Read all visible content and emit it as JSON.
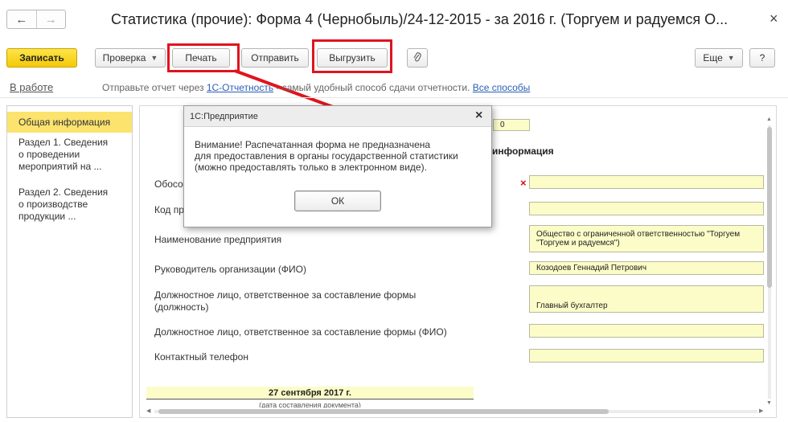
{
  "window": {
    "title": "Статистика (прочие): Форма 4 (Чернобыль)/24-12-2015 - за 2016 г. (Торгуем и радуемся О...",
    "back_icon": "←",
    "forward_icon": "→",
    "close_icon": "×"
  },
  "toolbar": {
    "save": "Записать",
    "check": "Проверка",
    "print": "Печать",
    "send": "Отправить",
    "export": "Выгрузить",
    "attach_icon": "paperclip-icon",
    "more": "Еще",
    "help": "?"
  },
  "info_bar": {
    "status": "В работе",
    "text_before": "Отправьте отчет через ",
    "link1": "1С-Отчетность",
    "text_middle": " - самый удобный способ сдачи отчетности. ",
    "link2": "Все способы"
  },
  "sidebar": {
    "items": [
      {
        "label": "Общая информация"
      },
      {
        "line1": "Раздел 1. Сведения",
        "line2": "о проведении",
        "line3": "мероприятий на ..."
      },
      {
        "line1": "Раздел 2. Сведения",
        "line2": "о производстве",
        "line3": "продукции ..."
      }
    ]
  },
  "form": {
    "top_value": "0",
    "section_heading": "информация",
    "labels": {
      "obosob": "Обосо",
      "kod": "Код пр",
      "name": "Наименование предприятия",
      "head": "Руководитель организации (ФИО)",
      "official_pos_1": "Должностное лицо, ответственное за составление формы",
      "official_pos_2": "(должность)",
      "official_fio": "Должностное лицо, ответственное за составление формы (ФИО)",
      "phone": "Контактный телефон"
    },
    "values": {
      "name_1": "Общество с ограниченной ответственностью \"Торгуем",
      "name_2": "\"Торгуем и радуемся\")",
      "head": "Козодоев Геннадий Петрович",
      "position": "Главный бухгалтер"
    },
    "required_mark": "×",
    "date": "27 сентября 2017 г.",
    "date_caption": "(дата составления документа)"
  },
  "modal": {
    "title": "1С:Предприятие",
    "close_icon": "×",
    "line1": "Внимание! Распечатанная форма не предназначена",
    "line2": "для предоставления в органы государственной статистики",
    "line3": "(можно предоставлять только в электронном виде).",
    "ok": "ОК"
  },
  "colors": {
    "accent_yellow": "#f4c907",
    "field_yellow": "#fcfcc8",
    "highlight_red": "#e0141e",
    "link_blue": "#2b60b6"
  }
}
